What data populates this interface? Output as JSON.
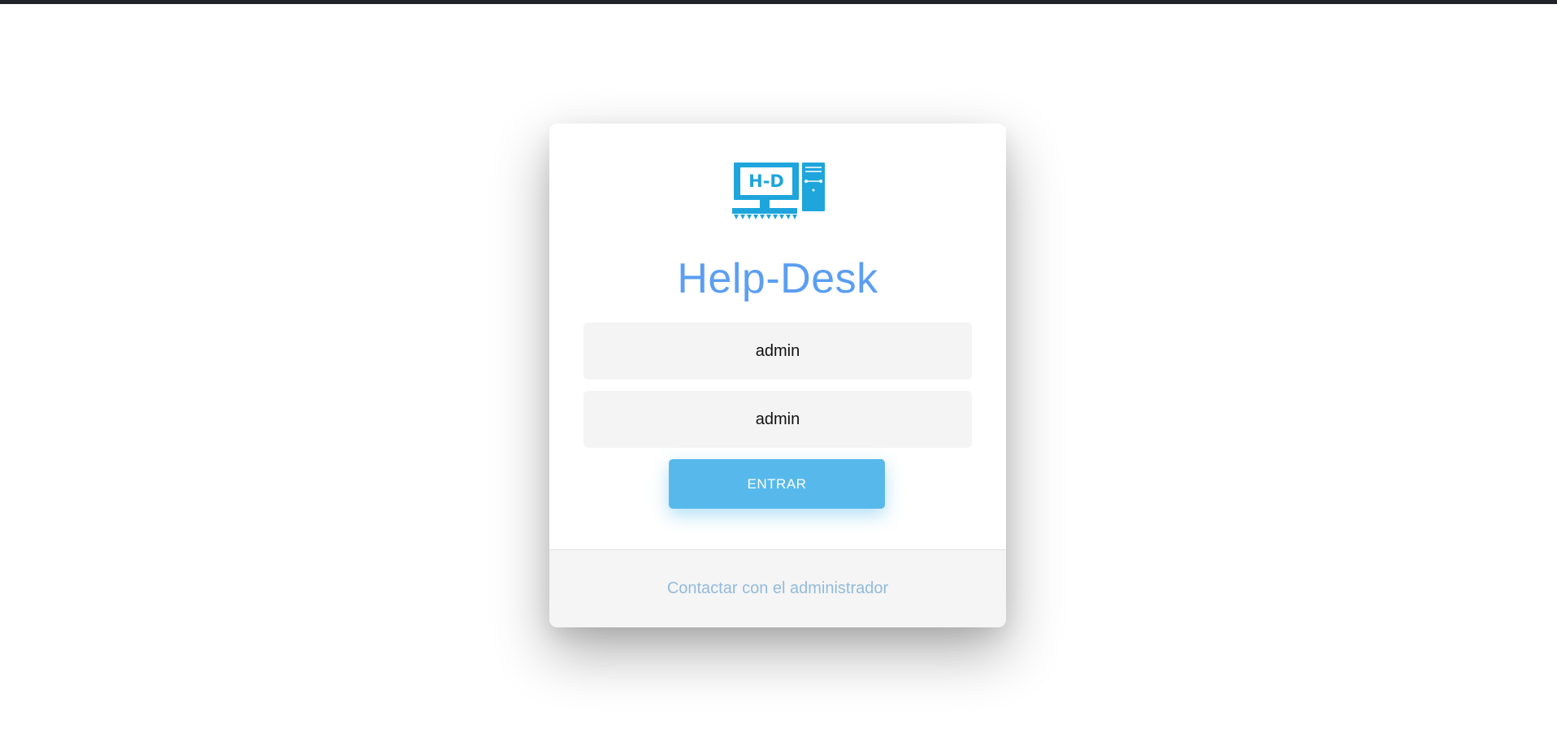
{
  "colors": {
    "accent": "#57b9eb",
    "title": "#5b9ef2",
    "logo": "#1ea5dc",
    "link": "#92bbdc",
    "field_bg": "#f4f4f4"
  },
  "logo": {
    "icon": "computer-monitor-tower-icon",
    "text": "H-D"
  },
  "login": {
    "title": "Help-Desk",
    "username_value": "admin",
    "password_value": "admin",
    "submit_label": "ENTRAR"
  },
  "footer": {
    "contact_link": "Contactar con el administrador"
  }
}
